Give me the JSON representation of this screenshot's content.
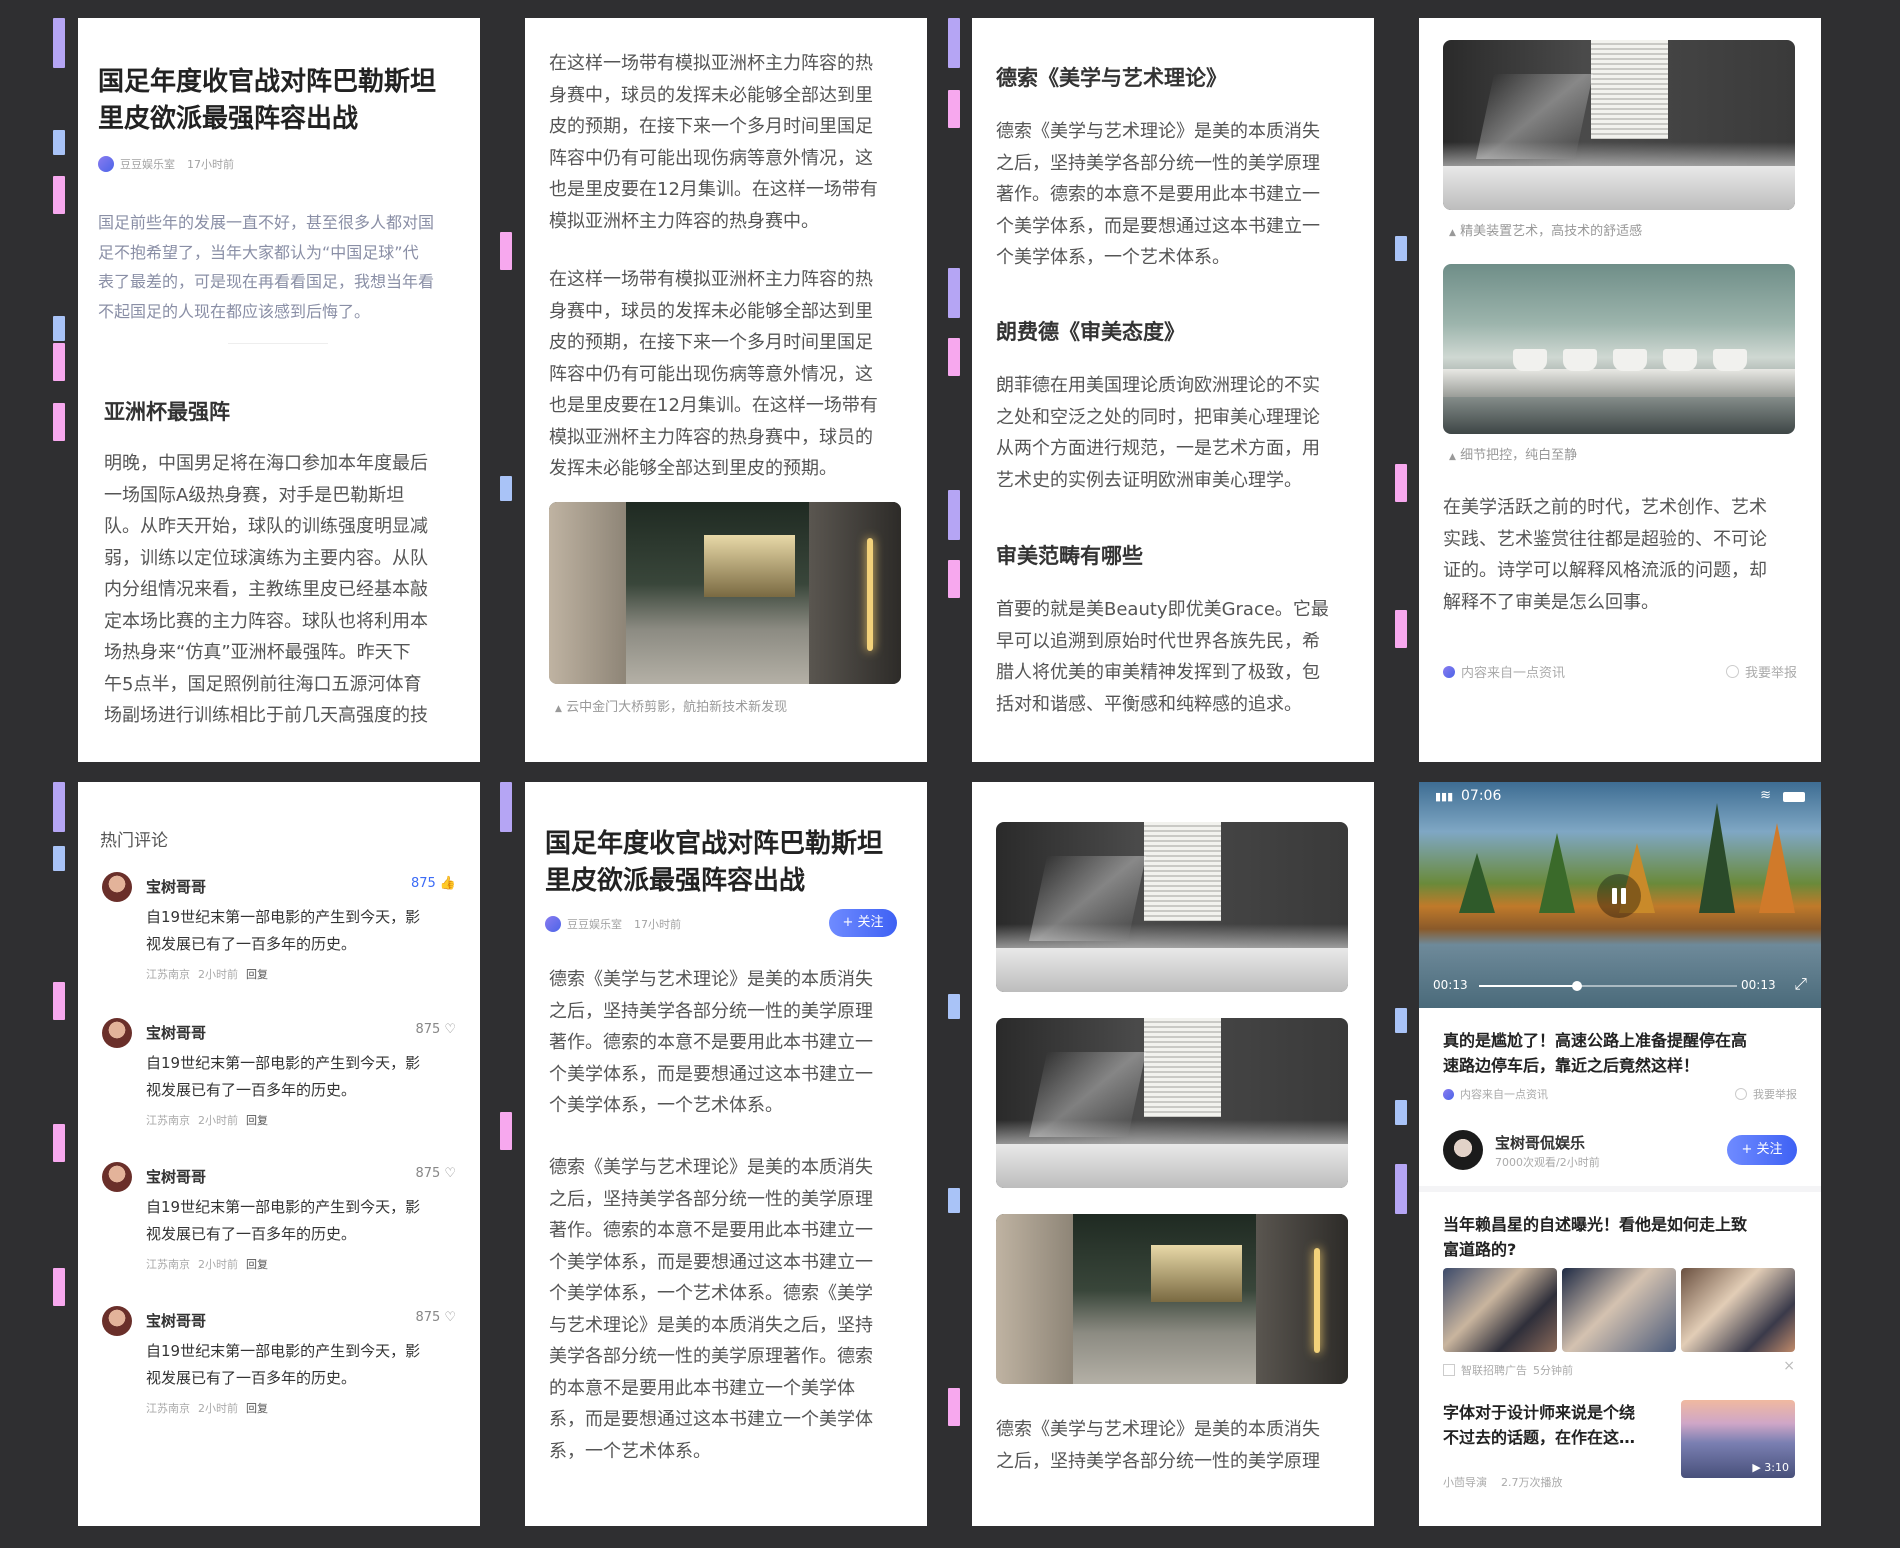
{
  "article": {
    "title_line1": "国足年度收官战对阵巴勒斯坦",
    "title_line2": "里皮欲派最强阵容出战",
    "source": "豆豆娱乐室",
    "time": "17小时前",
    "intro": [
      "国足前些年的发展一直不好，甚至很多人都对国",
      "足不抱希望了，当年大家都认为“中国足球”代",
      "表了最差的，可是现在再看看国足，我想当年看",
      "不起国足的人现在都应该感到后悔了。"
    ],
    "section_title": "亚洲杯最强阵",
    "body": [
      "明晚，中国男足将在海口参加本年度最后",
      "一场国际A级热身赛，对手是巴勒斯坦",
      "队。从昨天开始，球队的训练强度明显减",
      "弱，训练以定位球演练为主要内容。从队",
      "内分组情况来看，主教练里皮已经基本敲",
      "定本场比赛的主力阵容。球队也将利用本",
      "场热身来“仿真”亚洲杯最强阵。昨天下",
      "午5点半，国足照例前往海口五源河体育",
      "场副场进行训练相比于前几天高强度的技"
    ]
  },
  "card2": {
    "para1": [
      "在这样一场带有模拟亚洲杯主力阵容的热",
      "身赛中，球员的发挥未必能够全部达到里",
      "皮的预期，在接下来一个多月时间里国足",
      "阵容中仍有可能出现伤病等意外情况，这",
      "也是里皮要在12月集训。在这样一场带有",
      "模拟亚洲杯主力阵容的热身赛中。"
    ],
    "para2": [
      "在这样一场带有模拟亚洲杯主力阵容的热",
      "身赛中，球员的发挥未必能够全部达到里",
      "皮的预期，在接下来一个多月时间里国足",
      "阵容中仍有可能出现伤病等意外情况，这",
      "也是里皮要在12月集训。在这样一场带有",
      "模拟亚洲杯主力阵容的热身赛中，球员的",
      "发挥未必能够全部达到里皮的预期。"
    ],
    "caption": "云中金门大桥剪影，航拍新技术新发现"
  },
  "card3": {
    "s1_title": "德索《美学与艺术理论》",
    "s1_body": [
      "德索《美学与艺术理论》是美的本质消失",
      "之后，坚持美学各部分统一性的美学原理",
      "著作。德索的本意不是要用此本书建立一",
      "个美学体系，而是要想通过这本书建立一",
      "个美学体系，一个艺术体系。"
    ],
    "s2_title": "朗费德《审美态度》",
    "s2_body": [
      "朗菲德在用美国理论质询欧洲理论的不实",
      "之处和空泛之处的同时，把审美心理理论",
      "从两个方面进行规范，一是艺术方面，用",
      "艺术史的实例去证明欧洲审美心理学。"
    ],
    "s3_title": "审美范畴有哪些",
    "s3_body": [
      "首要的就是美Beauty即优美Grace。它最",
      "早可以追溯到原始时代世界各族先民，希",
      "腊人将优美的审美精神发挥到了极致，包",
      "括对和谐感、平衡感和纯粹感的追求。"
    ]
  },
  "card4": {
    "caption1": "精美装置艺术，高技术的舒适感",
    "caption2": "细节把控，纯白至静",
    "body": [
      "在美学活跃之前的时代，艺术创作、艺术",
      "实践、艺术鉴赏往往都是超验的、不可论",
      "证的。诗学可以解释风格流派的问题，却",
      "解释不了审美是怎么回事。"
    ],
    "source": "内容来自一点资讯",
    "report": "我要举报"
  },
  "comments": {
    "header": "热门评论",
    "items": [
      {
        "name": "宝树哥哥",
        "likes": "875",
        "line1": "自19世纪末第一部电影的产生到今天，影",
        "line2": "视发展已有了一百多年的历史。",
        "location": "江苏南京",
        "time": "2小时前",
        "reply": "回复"
      },
      {
        "name": "宝树哥哥",
        "likes": "875",
        "line1": "自19世纪末第一部电影的产生到今天，影",
        "line2": "视发展已有了一百多年的历史。",
        "location": "江苏南京",
        "time": "2小时前",
        "reply": "回复"
      },
      {
        "name": "宝树哥哥",
        "likes": "875",
        "line1": "自19世纪末第一部电影的产生到今天，影",
        "line2": "视发展已有了一百多年的历史。",
        "location": "江苏南京",
        "time": "2小时前",
        "reply": "回复"
      },
      {
        "name": "宝树哥哥",
        "likes": "875",
        "line1": "自19世纪末第一部电影的产生到今天，影",
        "line2": "视发展已有了一百多年的历史。",
        "location": "江苏南京",
        "time": "2小时前",
        "reply": "回复"
      }
    ]
  },
  "card6": {
    "title_line1": "国足年度收官战对阵巴勒斯坦",
    "title_line2": "里皮欲派最强阵容出战",
    "source": "豆豆娱乐室",
    "time": "17小时前",
    "follow": "+ 关注",
    "para1": [
      "德索《美学与艺术理论》是美的本质消失",
      "之后，坚持美学各部分统一性的美学原理",
      "著作。德索的本意不是要用此本书建立一",
      "个美学体系，而是要想通过这本书建立一",
      "个美学体系，一个艺术体系。"
    ],
    "para2": [
      "德索《美学与艺术理论》是美的本质消失",
      "之后，坚持美学各部分统一性的美学原理",
      "著作。德索的本意不是要用此本书建立一",
      "个美学体系，而是要想通过这本书建立一",
      "个美学体系，一个艺术体系。德索《美学",
      "与艺术理论》是美的本质消失之后，坚持",
      "美学各部分统一性的美学原理著作。德索",
      "的本意不是要用此本书建立一个美学体",
      "系，而是要想通过这本书建立一个美学体",
      "系，一个艺术体系。"
    ]
  },
  "card7": {
    "body": [
      "德索《美学与艺术理论》是美的本质消失",
      "之后，坚持美学各部分统一性的美学原理"
    ]
  },
  "card8": {
    "status_time": "07:06",
    "elapsed": "00:13",
    "duration": "00:13",
    "progress": 0.38,
    "video_title_line1": "真的是尴尬了！高速公路上准备提醒停在高",
    "video_title_line2": "速路边停车后，靠近之后竟然这样！",
    "source": "内容来自一点资讯",
    "report": "我要举报",
    "author": "宝树哥侃娱乐",
    "author_meta": "7000次观看/2小时前",
    "follow": "+ 关注",
    "news1_line1": "当年赖昌星的自述曝光！看他是如何走上致",
    "news1_line2": "富道路的?",
    "ad_label": "智联招聘广告",
    "ad_time": "5分钟前",
    "close": "×",
    "news2_line1": "字体对于设计师来说是个绕",
    "news2_line2": "不过去的话题，在作在这…",
    "news2_source": "小茴导演",
    "news2_views": "2.7万次播放",
    "news2_duration": "▶ 3:10"
  }
}
